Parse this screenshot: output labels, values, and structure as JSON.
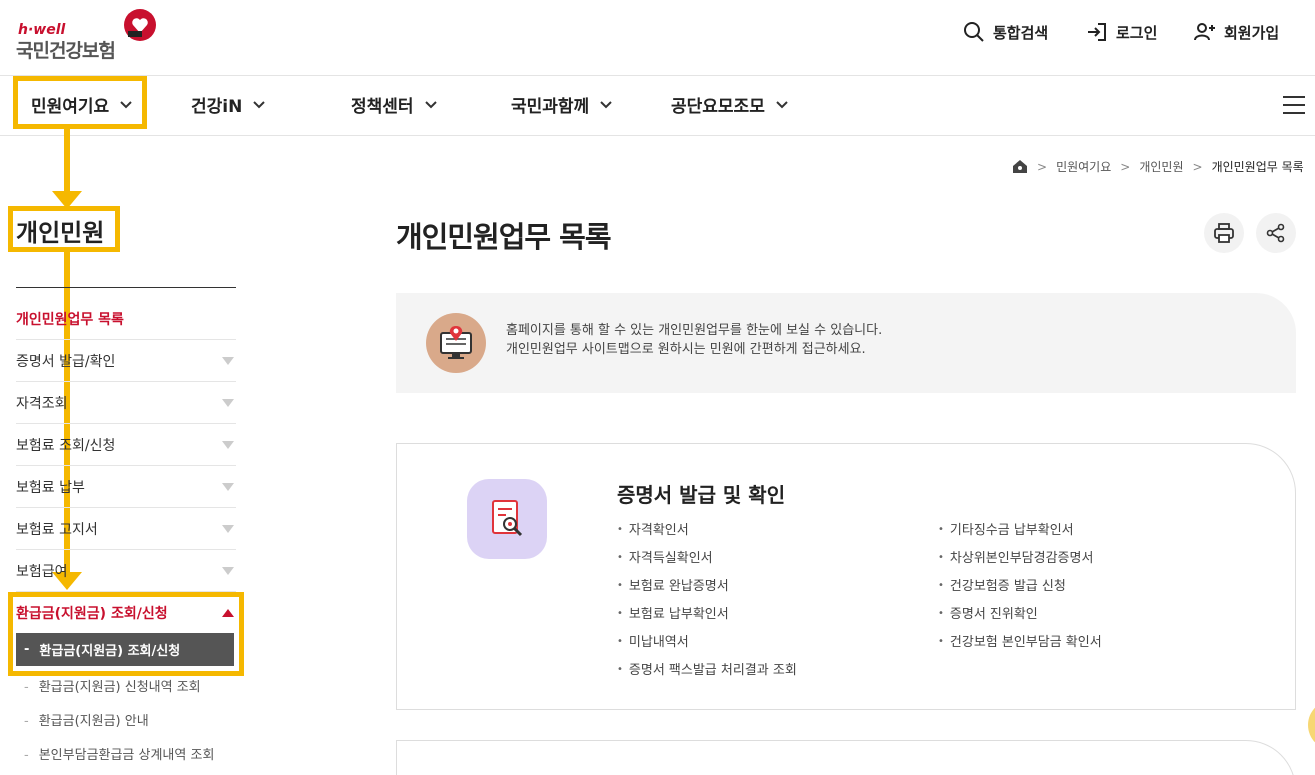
{
  "header": {
    "brand": "h·well",
    "site_name": "국민건강보험",
    "search_label": "통합검색",
    "login_label": "로그인",
    "signup_label": "회원가입"
  },
  "gnb": {
    "items": [
      {
        "label": "민원여기요"
      },
      {
        "label": "건강iN"
      },
      {
        "label": "정책센터"
      },
      {
        "label": "국민과함께"
      },
      {
        "label": "공단요모조모"
      }
    ]
  },
  "breadcrumb": {
    "items": [
      "민원여기요",
      "개인민원",
      "개인민원업무 목록"
    ]
  },
  "sidebar": {
    "title": "개인민원",
    "items": [
      {
        "label": "개인민원업무 목록"
      },
      {
        "label": "증명서 발급/확인"
      },
      {
        "label": "자격조회"
      },
      {
        "label": "보험료 조회/신청"
      },
      {
        "label": "보험료 납부"
      },
      {
        "label": "보험료 고지서"
      },
      {
        "label": "보험급여"
      },
      {
        "label": "환급금(지원금) 조회/신청"
      }
    ],
    "sub_items": [
      {
        "label": "환급금(지원금) 조회/신청"
      },
      {
        "label": "환급금(지원금) 신청내역 조회"
      },
      {
        "label": "환급금(지원금) 안내"
      },
      {
        "label": "본인부담금환급금 상계내역 조회"
      }
    ]
  },
  "main": {
    "title": "개인민원업무 목록",
    "info_line1": "홈페이지를 통해 할 수 있는 개인민원업무를 한눈에 보실 수 있습니다.",
    "info_line2": "개인민원업무 사이트맵으로 원하시는 민원에 간편하게 접근하세요.",
    "card": {
      "title": "증명서 발급 및 확인",
      "left": [
        "자격확인서",
        "자격득실확인서",
        "보험료 완납증명서",
        "보험료 납부확인서",
        "미납내역서",
        "증명서 팩스발급 처리결과 조회"
      ],
      "right": [
        "기타징수금 납부확인서",
        "차상위본인부담경감증명서",
        "건강보험증 발급 신청",
        "증명서 진위확인",
        "건강보험 본인부담금 확인서"
      ]
    }
  },
  "colors": {
    "accent_red": "#c8102e",
    "highlight_yellow": "#f5b800"
  }
}
